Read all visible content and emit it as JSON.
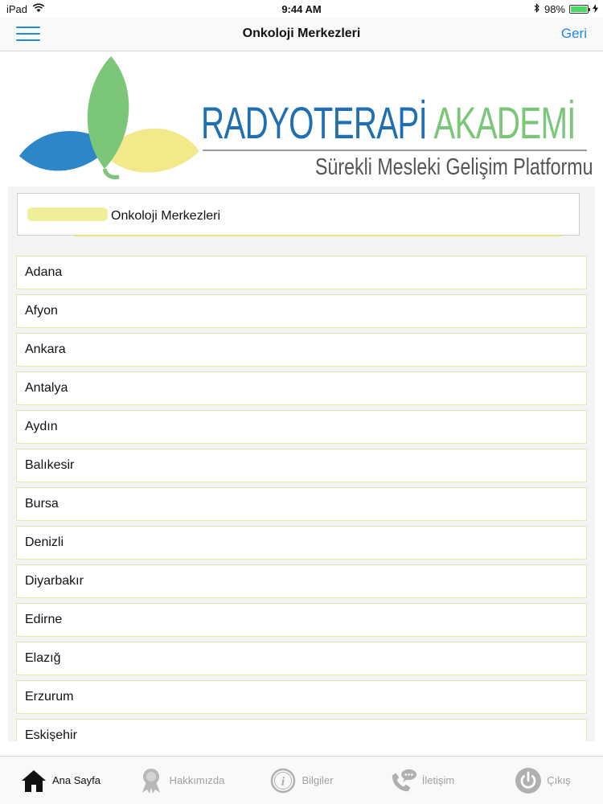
{
  "status_bar": {
    "device": "iPad",
    "time": "9:44 AM",
    "battery": "98%",
    "battery_level": 0.98
  },
  "nav": {
    "title": "Onkoloji Merkezleri",
    "back_label": "Geri"
  },
  "banner": {
    "brand_part1": "RADYOTERAPİ",
    "brand_part2": "AKADEMİ",
    "tagline": "Sürekli Mesleki Gelişim Platformu"
  },
  "header": {
    "title": "Onkoloji Merkezleri"
  },
  "cities": [
    "Adana",
    "Afyon",
    "Ankara",
    "Antalya",
    "Aydın",
    "Balıkesir",
    "Bursa",
    "Denizli",
    "Diyarbakır",
    "Edirne",
    "Elazığ",
    "Erzurum",
    "Eskişehir"
  ],
  "tabs": [
    {
      "label": "Ana Sayfa",
      "icon": "home-icon",
      "active": true
    },
    {
      "label": "Hakkımızda",
      "icon": "award-icon",
      "active": false
    },
    {
      "label": "Bilgiler",
      "icon": "info-icon",
      "active": false
    },
    {
      "label": "İletişim",
      "icon": "phone-chat-icon",
      "active": false
    },
    {
      "label": "Çıkış",
      "icon": "power-icon",
      "active": false
    }
  ],
  "colors": {
    "accent": "#1e88e5",
    "brand_blue": "#1f6fb3",
    "brand_green": "#7cc67a",
    "leaf_yellow": "#f2ea8a",
    "list_border": "#e3e6a8"
  }
}
